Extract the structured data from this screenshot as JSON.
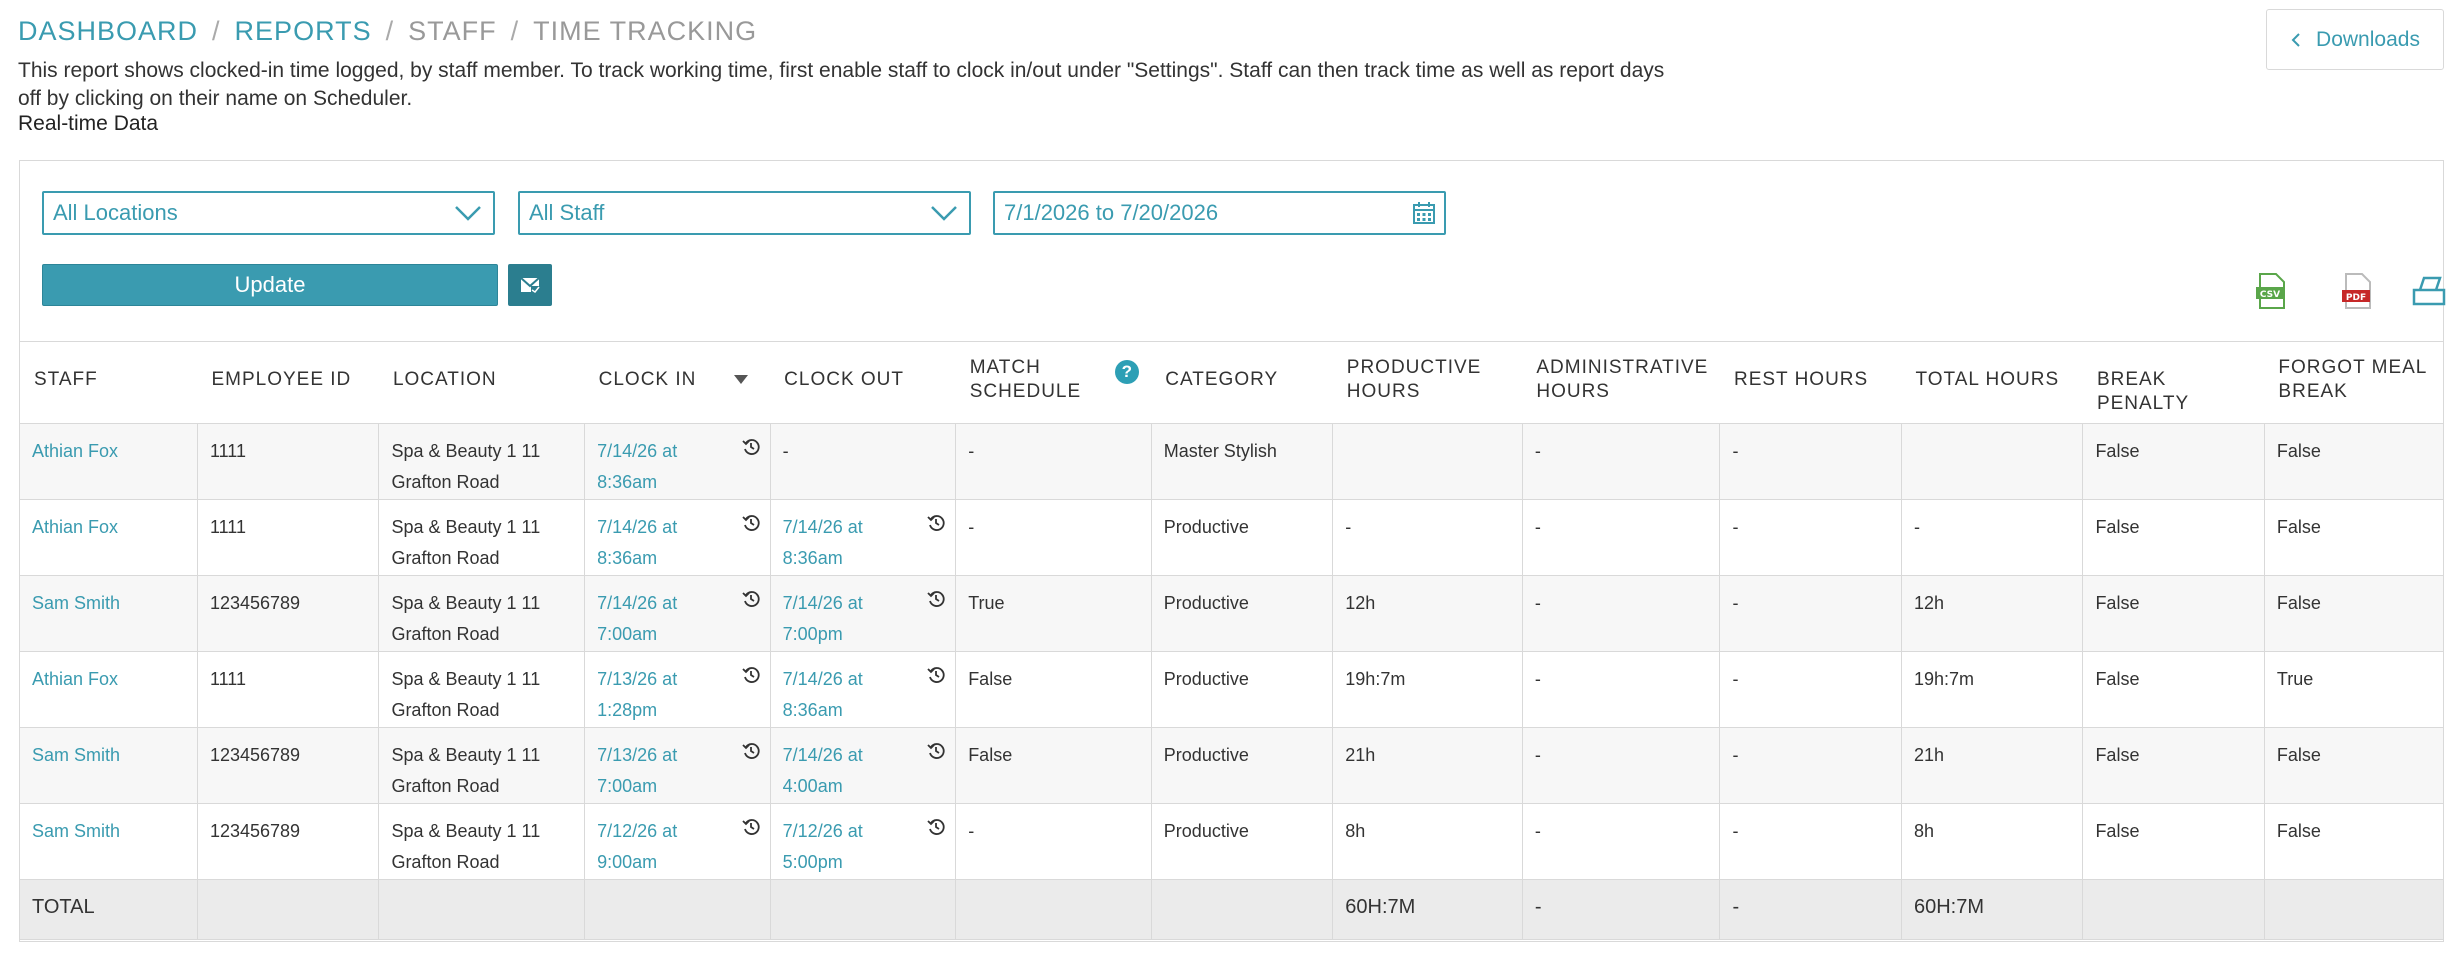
{
  "breadcrumb": {
    "items": [
      "DASHBOARD",
      "REPORTS",
      "STAFF",
      "TIME TRACKING"
    ],
    "separator": "/"
  },
  "description": "This report shows clocked-in time logged, by staff member. To track working time, first enable staff to clock in/out under \"Settings\". Staff can then track time as well as report days off by clicking on their name on Scheduler.",
  "realtime_label": "Real-time Data",
  "downloads_label": "Downloads",
  "filters": {
    "location": "All Locations",
    "staff": "All Staff",
    "date_range": "7/1/2026 to 7/20/2026"
  },
  "update_label": "Update",
  "export_icons": [
    "csv-icon",
    "pdf-icon",
    "print-icon"
  ],
  "accent_color": "#3a9bb0",
  "table": {
    "headers": [
      "STAFF",
      "EMPLOYEE ID",
      "LOCATION",
      "CLOCK IN",
      "CLOCK OUT",
      "MATCH SCHEDULE",
      "CATEGORY",
      "PRODUCTIVE HOURS",
      "ADMINISTRATIVE HOURS",
      "REST HOURS",
      "TOTAL HOURS",
      "BREAK PENALTY",
      "FORGOT MEAL BREAK"
    ],
    "rows": [
      {
        "staff": "Athian Fox",
        "employee_id": "1111",
        "location": "Spa & Beauty 1 11 Grafton Road",
        "clock_in": "7/14/26 at 8:36am",
        "clock_out": "-",
        "match_schedule": "-",
        "category": "Master Stylish",
        "productive": "",
        "administrative": "-",
        "rest": "-",
        "total": "",
        "break_penalty": "False",
        "forgot_meal": "False"
      },
      {
        "staff": "Athian Fox",
        "employee_id": "1111",
        "location": "Spa & Beauty 1 11 Grafton Road",
        "clock_in": "7/14/26 at 8:36am",
        "clock_out": "7/14/26 at 8:36am",
        "match_schedule": "-",
        "category": "Productive",
        "productive": "-",
        "administrative": "-",
        "rest": "-",
        "total": "-",
        "break_penalty": "False",
        "forgot_meal": "False"
      },
      {
        "staff": "Sam Smith",
        "employee_id": "123456789",
        "location": "Spa & Beauty 1 11 Grafton Road",
        "clock_in": "7/14/26 at 7:00am",
        "clock_out": "7/14/26 at 7:00pm",
        "match_schedule": "True",
        "category": "Productive",
        "productive": "12h",
        "administrative": "-",
        "rest": "-",
        "total": "12h",
        "break_penalty": "False",
        "forgot_meal": "False"
      },
      {
        "staff": "Athian Fox",
        "employee_id": "1111",
        "location": "Spa & Beauty 1 11 Grafton Road",
        "clock_in": "7/13/26 at 1:28pm",
        "clock_out": "7/14/26 at 8:36am",
        "match_schedule": "False",
        "category": "Productive",
        "productive": "19h:7m",
        "administrative": "-",
        "rest": "-",
        "total": "19h:7m",
        "break_penalty": "False",
        "forgot_meal": "True"
      },
      {
        "staff": "Sam Smith",
        "employee_id": "123456789",
        "location": "Spa & Beauty 1 11 Grafton Road",
        "clock_in": "7/13/26 at 7:00am",
        "clock_out": "7/14/26 at 4:00am",
        "match_schedule": "False",
        "category": "Productive",
        "productive": "21h",
        "administrative": "-",
        "rest": "-",
        "total": "21h",
        "break_penalty": "False",
        "forgot_meal": "False"
      },
      {
        "staff": "Sam Smith",
        "employee_id": "123456789",
        "location": "Spa & Beauty 1 11 Grafton Road",
        "clock_in": "7/12/26 at 9:00am",
        "clock_out": "7/12/26 at 5:00pm",
        "match_schedule": "-",
        "category": "Productive",
        "productive": "8h",
        "administrative": "-",
        "rest": "-",
        "total": "8h",
        "break_penalty": "False",
        "forgot_meal": "False"
      }
    ],
    "total": {
      "label": "TOTAL",
      "productive": "60H:7M",
      "administrative": "-",
      "rest": "-",
      "total": "60H:7M"
    }
  }
}
